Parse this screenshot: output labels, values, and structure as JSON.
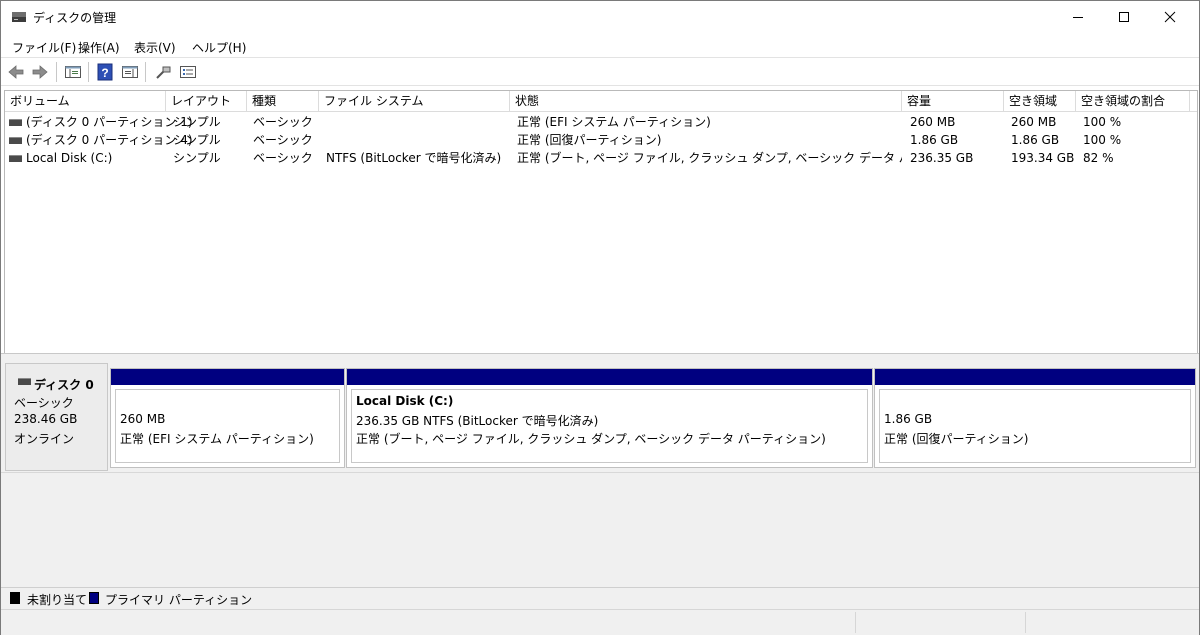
{
  "window": {
    "title": "ディスクの管理"
  },
  "menu": [
    "ファイル(F)",
    "操作(A)",
    "表示(V)",
    "ヘルプ(H)"
  ],
  "toolbar": [
    "back-icon",
    "forward-icon",
    "console-tree-icon",
    "help-icon",
    "properties-icon",
    "connect-icon",
    "settings-icon"
  ],
  "columns": [
    "ボリューム",
    "レイアウト",
    "種類",
    "ファイル システム",
    "状態",
    "容量",
    "空き領域",
    "空き領域の割合"
  ],
  "rows": [
    {
      "volume": "(ディスク 0 パーティション 1)",
      "layout": "シンプル",
      "type": "ベーシック",
      "fs": "",
      "status": "正常 (EFI システム パーティション)",
      "capacity": "260 MB",
      "free": "260 MB",
      "pct": "100 %"
    },
    {
      "volume": "(ディスク 0 パーティション 4)",
      "layout": "シンプル",
      "type": "ベーシック",
      "fs": "",
      "status": "正常 (回復パーティション)",
      "capacity": "1.86 GB",
      "free": "1.86 GB",
      "pct": "100 %"
    },
    {
      "volume": "Local Disk (C:)",
      "layout": "シンプル",
      "type": "ベーシック",
      "fs": "NTFS (BitLocker で暗号化済み)",
      "status": "正常 (ブート, ページ ファイル, クラッシュ ダンプ, ベーシック データ パーティション)",
      "capacity": "236.35 GB",
      "free": "193.34 GB",
      "pct": "82 %"
    }
  ],
  "disk": {
    "name": "ディスク 0",
    "type": "ベーシック",
    "size": "238.46 GB",
    "state": "オンライン"
  },
  "partitions": [
    {
      "title": "",
      "size": "260 MB",
      "status": "正常 (EFI システム パーティション)"
    },
    {
      "title": "Local Disk  (C:)",
      "size": "236.35 GB NTFS (BitLocker で暗号化済み)",
      "status": "正常 (ブート, ページ ファイル, クラッシュ ダンプ, ベーシック データ パーティション)"
    },
    {
      "title": "",
      "size": "1.86 GB",
      "status": "正常 (回復パーティション)"
    }
  ],
  "legend": [
    {
      "label": "未割り当て",
      "color": "#000000"
    },
    {
      "label": "プライマリ パーティション",
      "color": "#000080"
    }
  ]
}
